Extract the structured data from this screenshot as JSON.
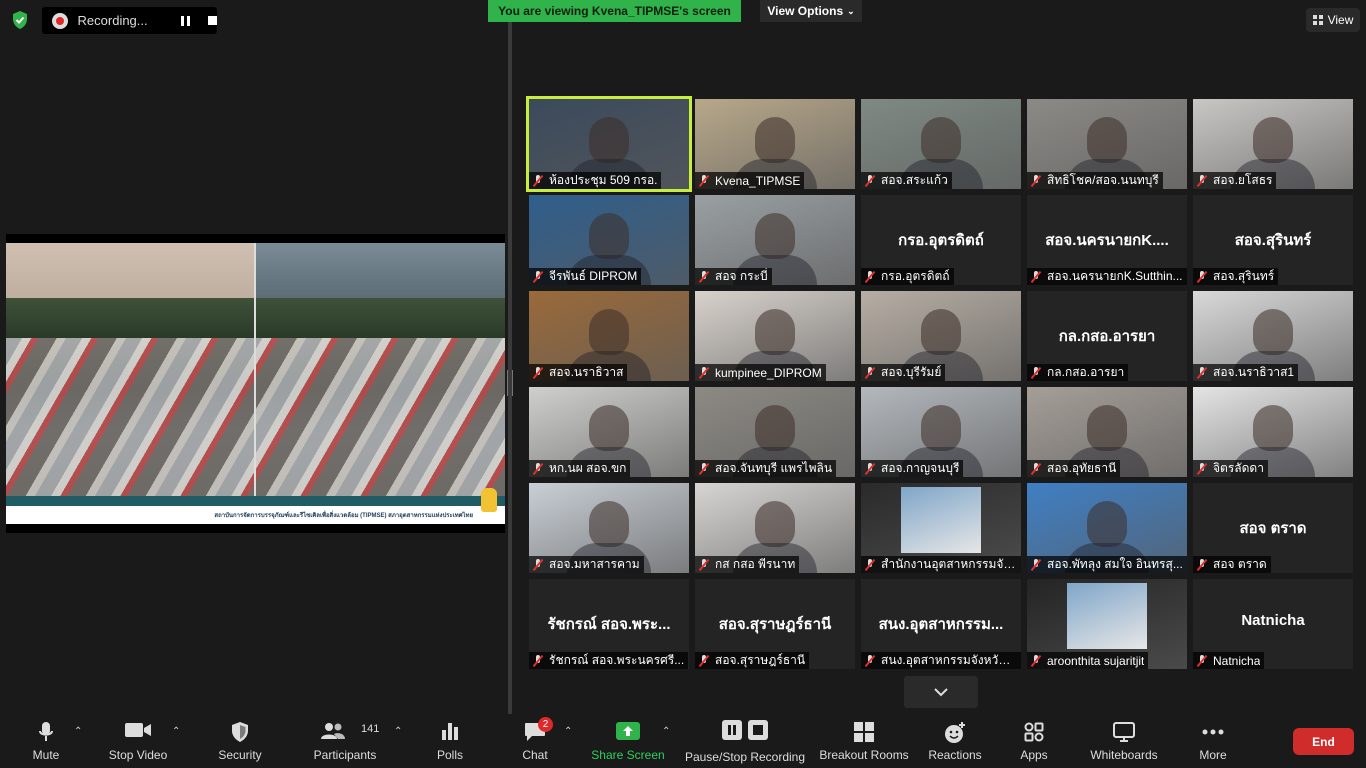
{
  "recording": {
    "label": "Recording..."
  },
  "banner": {
    "viewing": "You are viewing Kvena_TIPMSE's screen",
    "view_options": "View Options"
  },
  "view_button": {
    "label": "View"
  },
  "share_footer": "สถาบันการจัดการบรรจุภัณฑ์และรีไซเคิลเพื่อสิ่งแวดล้อม (TIPMSE) สภาอุตสาหกรรมแห่งประเทศไทย",
  "tiles": [
    {
      "caption": "ห้องประชุม 509 กรอ.",
      "big": "",
      "video": true,
      "color": "#3b4a5c"
    },
    {
      "caption": "Kvena_TIPMSE",
      "big": "",
      "video": true,
      "color": "#b8a88a"
    },
    {
      "caption": "สอจ.สระแก้ว",
      "big": "",
      "video": true,
      "color": "#7f8a84"
    },
    {
      "caption": "สิทธิโชค/สอจ.นนทบุรี",
      "big": "",
      "video": true,
      "color": "#8c8a86"
    },
    {
      "caption": "สอจ.ยโสธร",
      "big": "",
      "video": true,
      "color": "#c9c7c4"
    },
    {
      "caption": "จีรพันธ์ DIPROM",
      "big": "",
      "video": true,
      "color": "#2f5e8c"
    },
    {
      "caption": "สอจ กระบี่",
      "big": "",
      "video": true,
      "color": "#9aa0a3"
    },
    {
      "caption": "กรอ.อุตรดิตถ์",
      "big": "กรอ.อุตรดิตถ์",
      "video": false,
      "color": ""
    },
    {
      "caption": "สอจ.นครนายกK.Sutthin...",
      "big": "สอจ.นครนายกK....",
      "video": false,
      "color": ""
    },
    {
      "caption": "สอจ.สุรินทร์",
      "big": "สอจ.สุรินทร์",
      "video": false,
      "color": ""
    },
    {
      "caption": "สอจ.นราธิวาส",
      "big": "",
      "video": true,
      "color": "#9a6a3a"
    },
    {
      "caption": "kumpinee_DIPROM",
      "big": "",
      "video": true,
      "color": "#d8d2cc"
    },
    {
      "caption": "สอจ.บุรีรัมย์",
      "big": "",
      "video": true,
      "color": "#b7aea4"
    },
    {
      "caption": "กล.กสอ.อารยา",
      "big": "กล.กสอ.อารยา",
      "video": false,
      "color": ""
    },
    {
      "caption": "สอจ.นราธิวาส1",
      "big": "",
      "video": true,
      "color": "#d9d9d9"
    },
    {
      "caption": "หก.นผ สอจ.ขก",
      "big": "",
      "video": true,
      "color": "#cfd0cd"
    },
    {
      "caption": "สอจ.จันทบุรี แพรไพลิน",
      "big": "",
      "video": true,
      "color": "#8d8a84"
    },
    {
      "caption": "สอจ.กาญจนบุรี",
      "big": "",
      "video": true,
      "color": "#b3b8bd"
    },
    {
      "caption": "สอจ.อุทัยธานี",
      "big": "",
      "video": true,
      "color": "#a59e98"
    },
    {
      "caption": "จิตรลัดดา",
      "big": "",
      "video": true,
      "color": "#e4e4e4"
    },
    {
      "caption": "สอจ.มหาสารคาม",
      "big": "",
      "video": true,
      "color": "#c9cfd6"
    },
    {
      "caption": "กส กสอ พีรนาท",
      "big": "",
      "video": true,
      "color": "#d7d5d3"
    },
    {
      "caption": "สำนักงานอุตสาหกรรมจัง...",
      "big": "",
      "video": true,
      "color": "#2a2a2a"
    },
    {
      "caption": "สอจ.พัทลุง สมใจ อินทรสุ...",
      "big": "",
      "video": true,
      "color": "#3f7fc4"
    },
    {
      "caption": "สอจ ตราด",
      "big": "สอจ ตราด",
      "video": false,
      "color": ""
    },
    {
      "caption": "รัชกรณ์ สอจ.พระนครศรี...",
      "big": "รัชกรณ์ สอจ.พระ...",
      "video": false,
      "color": ""
    },
    {
      "caption": "สอจ.สุราษฎร์ธานี",
      "big": "สอจ.สุราษฎร์ธานี",
      "video": false,
      "color": ""
    },
    {
      "caption": "สนง.อุตสาหกรรมจังหวัดป...",
      "big": "สนง.อุตสาหกรรม...",
      "video": false,
      "color": ""
    },
    {
      "caption": "aroonthita sujaritjit",
      "big": "",
      "video": true,
      "color": "#242424"
    },
    {
      "caption": "Natnicha",
      "big": "Natnicha",
      "video": false,
      "color": ""
    }
  ],
  "toolbar": {
    "mute": "Mute",
    "stop_video": "Stop Video",
    "security": "Security",
    "participants": "Participants",
    "participants_count": "141",
    "polls": "Polls",
    "chat": "Chat",
    "chat_badge": "2",
    "share_screen": "Share Screen",
    "pause_recording": "Pause/Stop Recording",
    "breakout": "Breakout Rooms",
    "reactions": "Reactions",
    "apps": "Apps",
    "whiteboards": "Whiteboards",
    "more": "More",
    "end": "End"
  },
  "colors": {
    "accent_green": "#2fb34a",
    "end_red": "#d12c2c",
    "active_speaker": "#c7ee3d"
  }
}
